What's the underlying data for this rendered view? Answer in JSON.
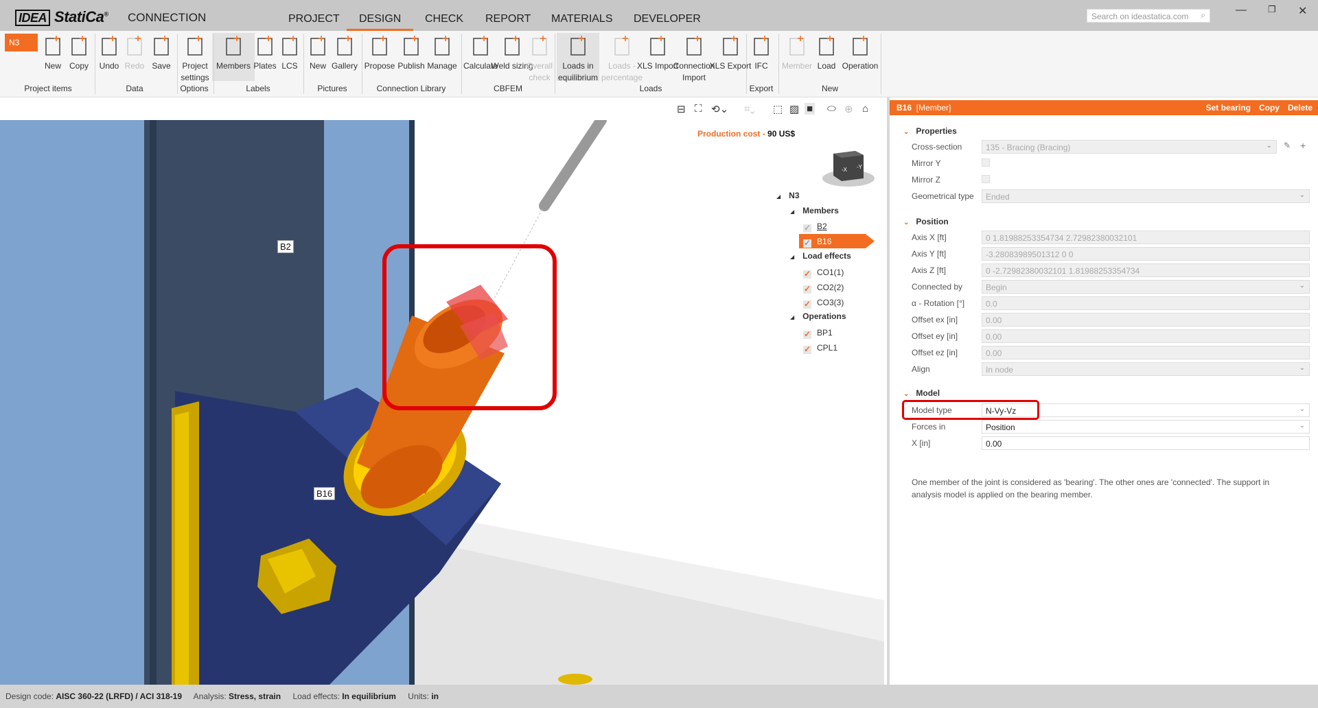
{
  "app": {
    "logo": "IDEA StatiCa",
    "product": "CONNECTION",
    "search_placeholder": "Search on ideastatica.com"
  },
  "tabs": [
    "PROJECT",
    "DESIGN",
    "CHECK",
    "REPORT",
    "MATERIALS",
    "DEVELOPER"
  ],
  "active_tab": "DESIGN",
  "ribbon": {
    "node_selector": "N3",
    "buttons": [
      "New",
      "Copy",
      "Undo",
      "Redo",
      "Save",
      "Project settings",
      "Members",
      "Plates",
      "LCS",
      "New",
      "Gallery",
      "Propose",
      "Publish",
      "Manage",
      "Calculate",
      "Weld sizing",
      "Overall check",
      "Loads in equilibrium",
      "Loads - percentage",
      "XLS Import",
      "Connection Import",
      "XLS Export",
      "IFC",
      "Member",
      "Load",
      "Operation"
    ],
    "groups": [
      "Project items",
      "Data",
      "Options",
      "Labels",
      "Pictures",
      "Connection Library",
      "CBFEM",
      "Loads",
      "Export",
      "New"
    ]
  },
  "viewport": {
    "production_cost_label": "Production cost",
    "production_cost_value": "90 US$",
    "labels": {
      "b2": "B2",
      "b16": "B16"
    },
    "cube": {
      "x": "-X",
      "y": "-Y"
    }
  },
  "tree": {
    "root": "N3",
    "members_label": "Members",
    "members": [
      "B2",
      "B16"
    ],
    "load_effects_label": "Load effects",
    "load_effects": [
      "CO1(1)",
      "CO2(2)",
      "CO3(3)"
    ],
    "operations_label": "Operations",
    "operations": [
      "BP1",
      "CPL1"
    ]
  },
  "panel": {
    "title": "B16",
    "subtitle": "[Member]",
    "actions": [
      "Set bearing",
      "Copy",
      "Delete"
    ],
    "properties": {
      "title": "Properties",
      "cross_section_label": "Cross-section",
      "cross_section": "135 - Bracing (Bracing)",
      "mirror_y_label": "Mirror Y",
      "mirror_z_label": "Mirror Z",
      "geo_type_label": "Geometrical type",
      "geo_type": "Ended"
    },
    "position": {
      "title": "Position",
      "axis_x_label": "Axis X [ft]",
      "axis_x": "0 1.81988253354734 2.72982380032101",
      "axis_y_label": "Axis Y [ft]",
      "axis_y": "-3.28083989501312 0 0",
      "axis_z_label": "Axis Z [ft]",
      "axis_z": "0 -2.72982380032101 1.81988253354734",
      "connected_by_label": "Connected by",
      "connected_by": "Begin",
      "rotation_label": "α - Rotation [°]",
      "rotation": "0.0",
      "offset_ex_label": "Offset ex [in]",
      "offset_ex": "0.00",
      "offset_ey_label": "Offset ey [in]",
      "offset_ey": "0.00",
      "offset_ez_label": "Offset ez [in]",
      "offset_ez": "0.00",
      "align_label": "Align",
      "align": "In node"
    },
    "model": {
      "title": "Model",
      "model_type_label": "Model type",
      "model_type": "N-Vy-Vz",
      "forces_in_label": "Forces in",
      "forces_in": "Position",
      "x_label": "X [in]",
      "x": "0.00"
    },
    "note": "One member of the joint is considered as 'bearing'. The other ones are 'connected'. The support in analysis model is applied on the bearing member."
  },
  "status": {
    "design_code_label": "Design code:",
    "design_code": "AISC 360-22 (LRFD) / ACI 318-19",
    "analysis_label": "Analysis:",
    "analysis": "Stress, strain",
    "load_effects_label": "Load effects:",
    "load_effects": "In equilibrium",
    "units_label": "Units:",
    "units": "in"
  },
  "colors": {
    "accent": "#f26d21",
    "highlight": "#e00000"
  }
}
